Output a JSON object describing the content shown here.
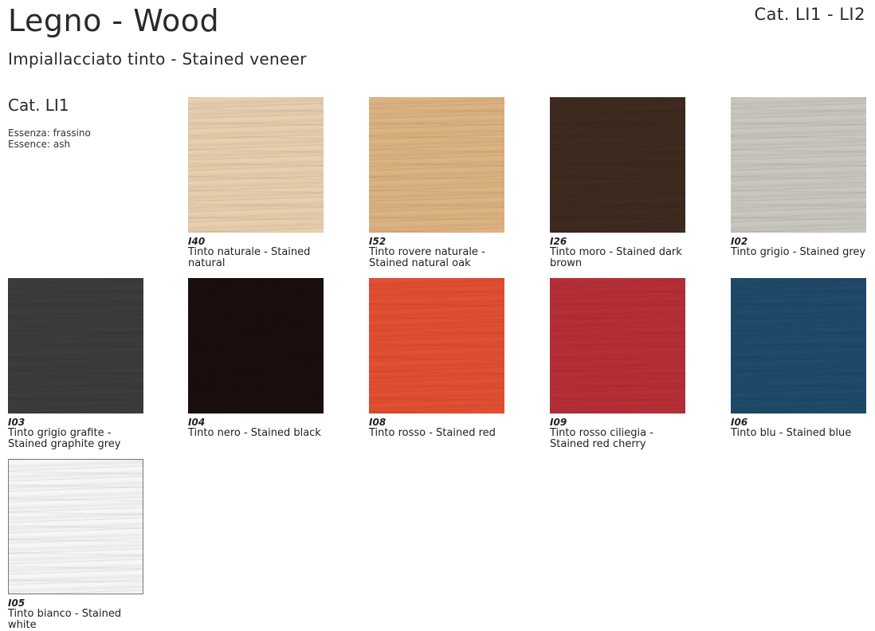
{
  "header": {
    "title": "Legno - Wood",
    "subtitle": "Impiallacciato tinto - Stained veneer",
    "category_range": "Cat. LI1 - LI2"
  },
  "section": {
    "category": "Cat. LI1",
    "essence_it": "Essenza: frassino",
    "essence_en": "Essence: ash"
  },
  "swatches": [
    {
      "code": "I40",
      "name": "Tinto naturale - Stained natural",
      "color": "#e8cfae"
    },
    {
      "code": "I52",
      "name": "Tinto rovere naturale - Stained natural oak",
      "color": "#ddb383"
    },
    {
      "code": "I26",
      "name": "Tinto moro - Stained dark brown",
      "color": "#3e2a1f"
    },
    {
      "code": "I02",
      "name": "Tinto grigio - Stained grey",
      "color": "#c9c7bf"
    },
    {
      "code": "I03",
      "name": "Tinto grigio grafite - Stained graphite grey",
      "color": "#3a3d3c"
    },
    {
      "code": "I04",
      "name": "Tinto nero - Stained black",
      "color": "#1a0f0e"
    },
    {
      "code": "I08",
      "name": "Tinto rosso - Stained red",
      "color": "#e34f32"
    },
    {
      "code": "I09",
      "name": "Tinto rosso ciliegia - Stained red cherry",
      "color": "#b72f36"
    },
    {
      "code": "I06",
      "name": "Tinto blu - Stained blue",
      "color": "#1f4a6a"
    },
    {
      "code": "I05",
      "name": "Tinto bianco - Stained white",
      "color": "#f6f6f4"
    }
  ]
}
